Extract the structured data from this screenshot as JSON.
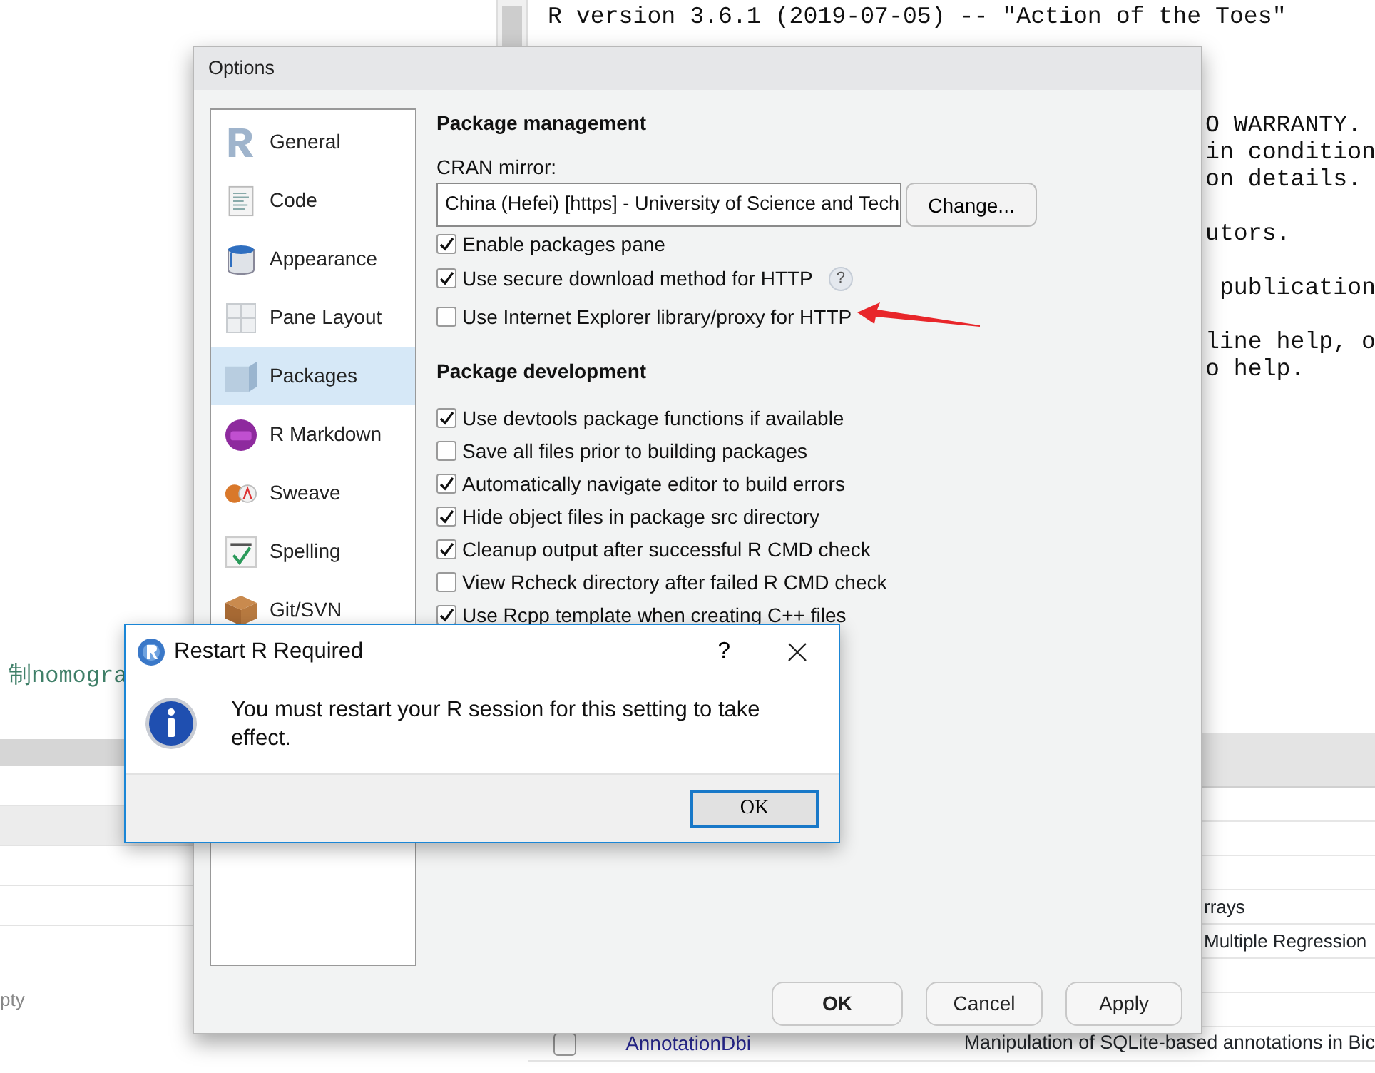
{
  "editor": {
    "line_fragment": "制nomogra"
  },
  "environment_pane": {
    "note": "pty"
  },
  "console": {
    "lines": [
      "R version 3.6.1 (2019-07-05) -- \"Action of the Toes\""
    ],
    "line_end_blocks": [
      [
        "O WARRANTY.",
        "in condition",
        "on details."
      ],
      [
        "utors."
      ],
      [
        " publication"
      ],
      [
        "line help, o",
        "o help."
      ]
    ]
  },
  "packages_pane": {
    "fragments": [
      "rrays",
      "Multiple Regression"
    ],
    "rows": [
      {
        "checked": false,
        "name": "AnnotationDbi",
        "description": "Manipulation of SQLite-based annotations in Bic"
      }
    ]
  },
  "options": {
    "title": "Options",
    "categories": [
      {
        "label": "General",
        "kind": "r",
        "selected": false
      },
      {
        "label": "Code",
        "kind": "document",
        "selected": false
      },
      {
        "label": "Appearance",
        "kind": "bucket",
        "selected": false
      },
      {
        "label": "Pane Layout",
        "kind": "panes",
        "selected": false
      },
      {
        "label": "Packages",
        "kind": "box",
        "selected": true
      },
      {
        "label": "R Markdown",
        "kind": "rmd",
        "selected": false
      },
      {
        "label": "Sweave",
        "kind": "sweave",
        "selected": false
      },
      {
        "label": "Spelling",
        "kind": "spelling",
        "selected": false
      },
      {
        "label": "Git/SVN",
        "kind": "crate",
        "selected": false
      }
    ],
    "sections": [
      {
        "heading": "Package management",
        "mirror": {
          "label": "CRAN mirror:",
          "value": "China (Hefei) [https] - University of Science and Tech",
          "button": "Change..."
        },
        "options": [
          {
            "label": "Enable packages pane",
            "checked": true
          },
          {
            "label": "Use secure download method for HTTP",
            "checked": true,
            "help": "?"
          },
          {
            "label": "Use Internet Explorer library/proxy for HTTP",
            "checked": false,
            "annotated": true
          }
        ]
      },
      {
        "heading": "Package development",
        "options": [
          {
            "label": "Use devtools package functions if available",
            "checked": true
          },
          {
            "label": "Save all files prior to building packages",
            "checked": false
          },
          {
            "label": "Automatically navigate editor to build errors",
            "checked": true
          },
          {
            "label": "Hide object files in package src directory",
            "checked": true
          },
          {
            "label": "Cleanup output after successful R CMD check",
            "checked": true
          },
          {
            "label": "View Rcheck directory after failed R CMD check",
            "checked": false
          },
          {
            "label": "Use Rcpp template when creating C++ files",
            "checked": true
          }
        ]
      }
    ],
    "buttons": [
      {
        "label": "OK",
        "default": true
      },
      {
        "label": "Cancel",
        "default": false
      },
      {
        "label": "Apply",
        "default": false
      }
    ]
  },
  "restart_dialog": {
    "title": "Restart R Required",
    "help": "?",
    "message": "You must restart your R session for this setting to take effect.",
    "button": "OK"
  }
}
